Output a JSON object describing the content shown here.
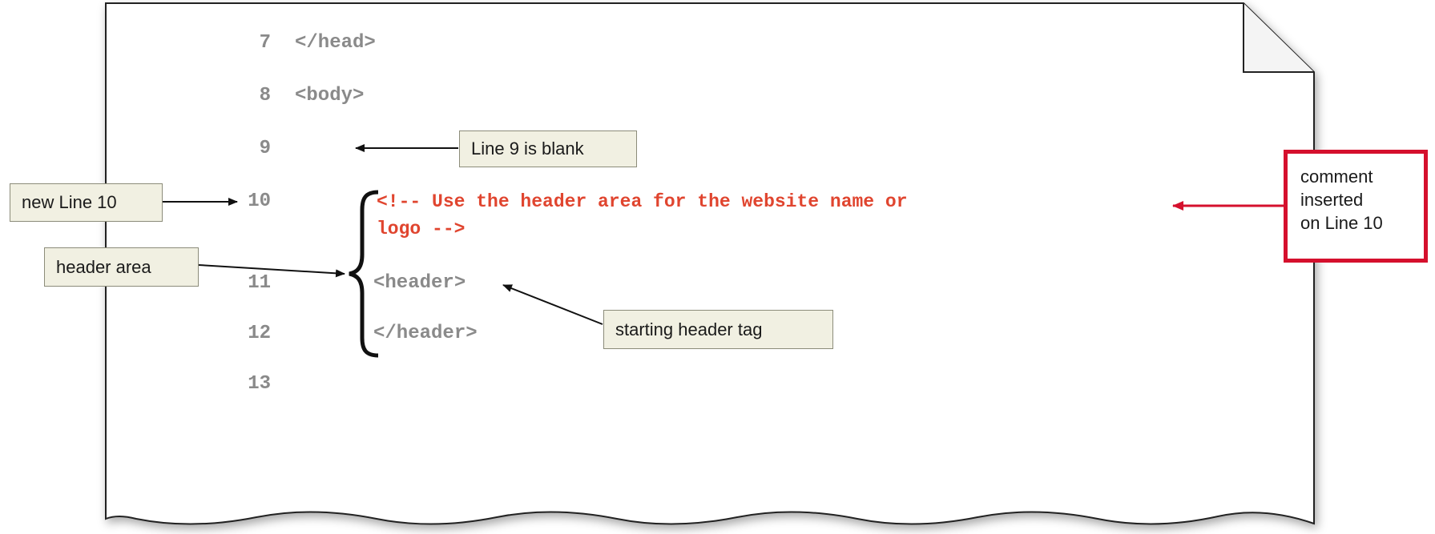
{
  "code_lines": [
    {
      "number": "7",
      "text": "</head>"
    },
    {
      "number": "8",
      "text": "<body>"
    },
    {
      "number": "9",
      "text": ""
    },
    {
      "number": "10",
      "text": "<!-- Use the header area for the website name or",
      "continuation": "logo -->"
    },
    {
      "number": "11",
      "text": "<header>"
    },
    {
      "number": "12",
      "text": "</header>"
    },
    {
      "number": "13",
      "text": ""
    }
  ],
  "callouts": {
    "line9": "Line 9 is blank",
    "new_line10": "new Line 10",
    "header_area": "header area",
    "starting_tag": "starting header tag",
    "comment_inserted": [
      "comment",
      "inserted",
      "on Line 10"
    ]
  },
  "colors": {
    "code_gray": "#8a8a8a",
    "comment_red": "#e0452f",
    "callout_fill": "#f1f0e2",
    "highlight_border": "#d5102d"
  }
}
